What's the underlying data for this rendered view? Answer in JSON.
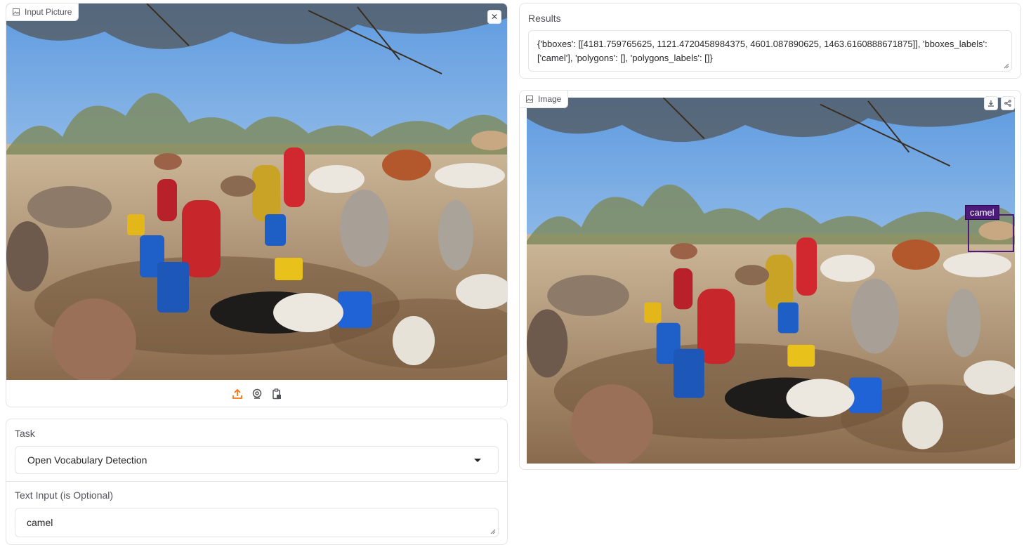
{
  "input_panel": {
    "label": "Input Picture",
    "clear_icon": "close-icon",
    "source_icons": [
      "upload-icon",
      "webcam-icon",
      "clipboard-icon"
    ],
    "accent_color": "#f97316"
  },
  "task": {
    "label": "Task",
    "selected": "Open Vocabulary Detection"
  },
  "text_input": {
    "label": "Text Input (is Optional)",
    "value": "camel"
  },
  "results": {
    "label": "Results",
    "value": "{'bboxes': [[4181.759765625, 1121.4720458984375, 4601.087890625, 1463.6160888671875]], 'bboxes_labels': ['camel'], 'polygons': [], 'polygons_labels': []}"
  },
  "output": {
    "label": "Image",
    "icons": [
      "download-icon",
      "share-icon"
    ],
    "detection_label": "camel",
    "box_color": "#4b1a7c"
  }
}
